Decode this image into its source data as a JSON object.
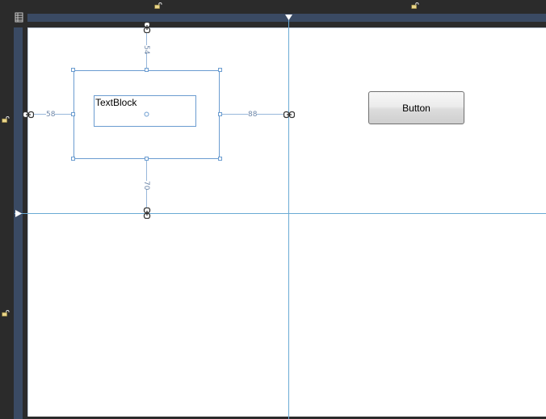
{
  "designer": {
    "textblock": {
      "text": "TextBlock"
    },
    "button": {
      "label": "Button"
    },
    "margins": {
      "top": "54",
      "left": "58",
      "right": "88",
      "bottom": "70"
    }
  },
  "colors": {
    "ruler": "#3a4a63",
    "gridline": "#6aaad4",
    "adorner": "#6b9cd0",
    "background": "#2b2b2b"
  },
  "icons": {
    "lock": "open-padlock-icon",
    "chain": "link-chain-icon",
    "corner": "grid-toggle-icon"
  }
}
